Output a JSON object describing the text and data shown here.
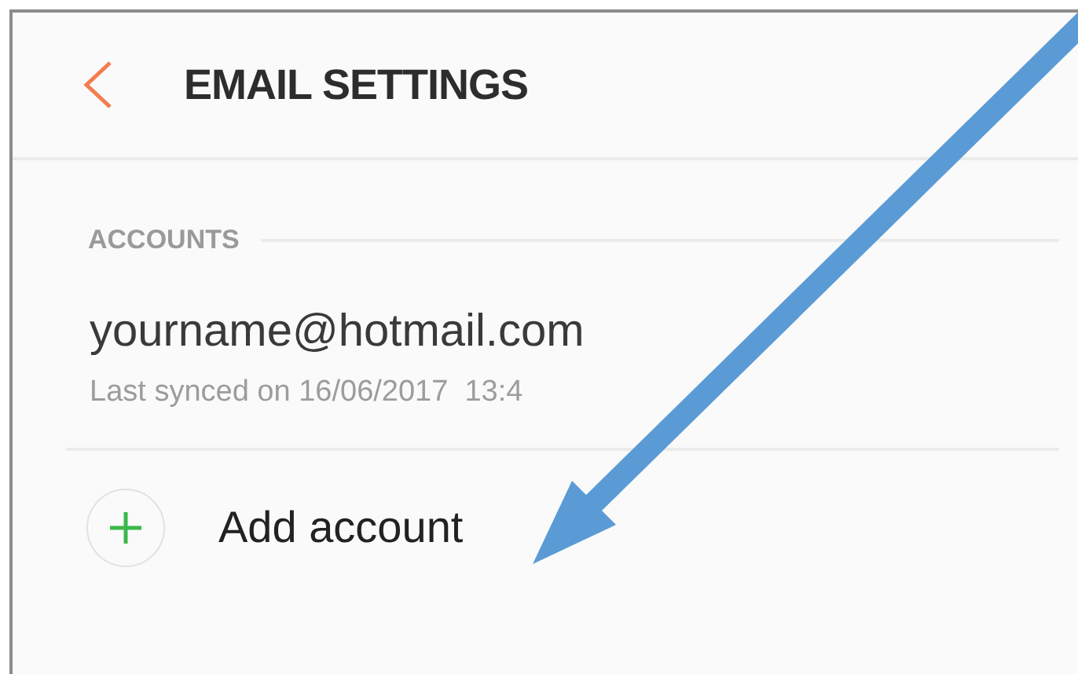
{
  "header": {
    "title": "EMAIL SETTINGS"
  },
  "section": {
    "label": "ACCOUNTS"
  },
  "accounts": [
    {
      "email": "yourname@hotmail.com",
      "sync_status": "Last synced on 16/06/2017  13:4"
    }
  ],
  "add_account": {
    "label": "Add account"
  }
}
